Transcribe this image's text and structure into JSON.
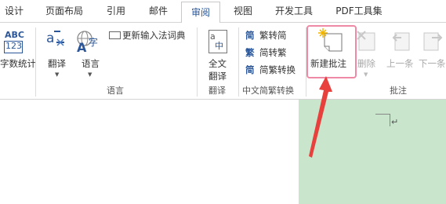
{
  "tabs": [
    {
      "label": "设计"
    },
    {
      "label": "页面布局"
    },
    {
      "label": "引用"
    },
    {
      "label": "邮件"
    },
    {
      "label": "审阅",
      "active": true
    },
    {
      "label": "视图"
    },
    {
      "label": "开发工具"
    },
    {
      "label": "PDF工具集"
    }
  ],
  "proofing": {
    "abc_text": "ABC",
    "num_text": "123",
    "word_count_label": "字数统计"
  },
  "language": {
    "translate_label": "翻译",
    "language_label": "语言",
    "ime_label": "更新输入法词典",
    "group_label": "语言"
  },
  "translate_group": {
    "full_translate_line1": "全文",
    "full_translate_line2": "翻译",
    "group_label": "翻译",
    "glyph": "中"
  },
  "chinese": {
    "trad_label": "繁转简",
    "simp_label": "简转繁",
    "convert_label": "简繁转换",
    "group_label": "中文简繁转换",
    "trad_glyph": "简",
    "simp_glyph": "繁",
    "convert_glyph": "简"
  },
  "comments": {
    "new_label": "新建批注",
    "delete_label": "删除",
    "prev_label": "上一条",
    "next_label": "下一条",
    "group_label": "批注"
  },
  "colors": {
    "accent": "#2b579a",
    "highlight": "#ef8aa6",
    "arrow": "#e8403c",
    "doc_green": "#c9e6cd"
  }
}
